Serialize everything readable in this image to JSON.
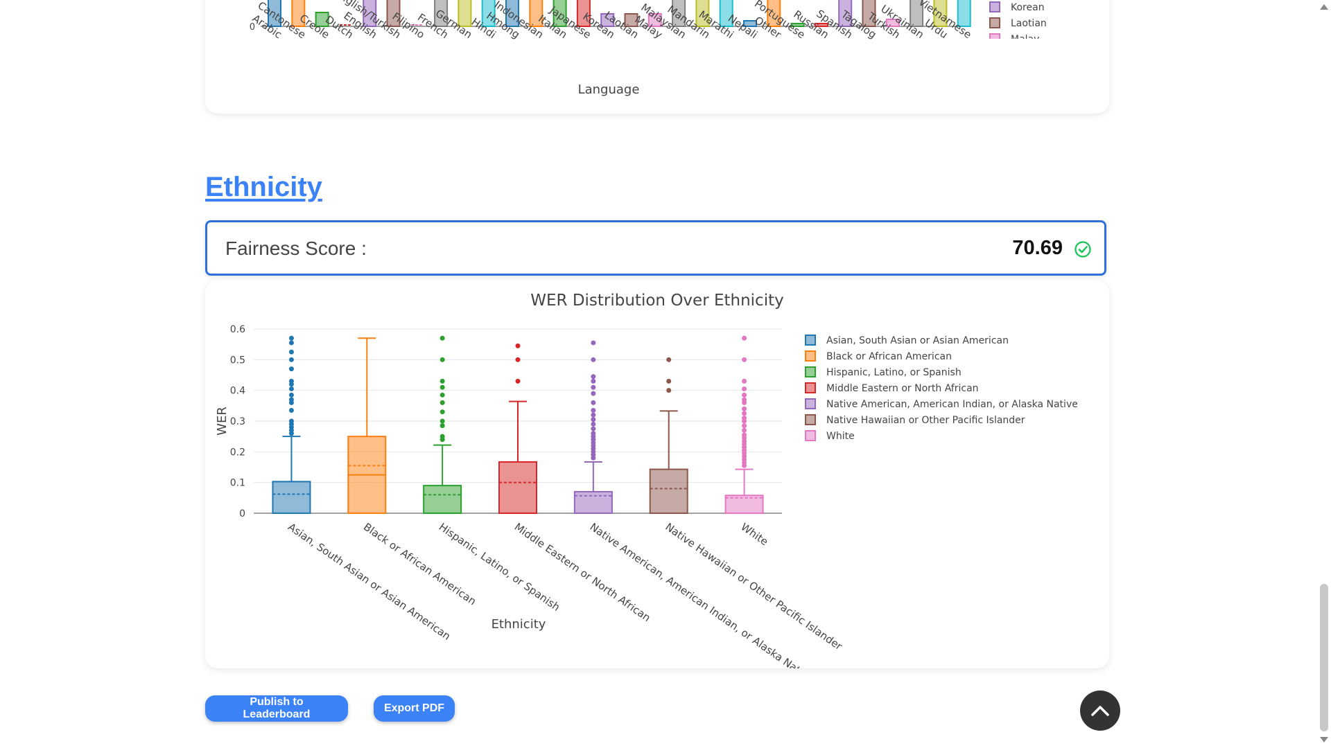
{
  "language_section": {
    "xlabel": "Language",
    "categories": [
      "Arabic",
      "Cantonese",
      "Creole",
      "Dutch",
      "English",
      "English/Turkish",
      "Filipino",
      "French",
      "German",
      "Hindi",
      "Hmong",
      "Indonesian",
      "Italian",
      "Japanese",
      "Korean",
      "Laotian",
      "Malay",
      "Malaysian",
      "Mandarin",
      "Marathi",
      "Nepali",
      "Other",
      "Portuguese",
      "Russian",
      "Spanish",
      "Tagalog",
      "Turkish",
      "Ukrainian",
      "Urdu",
      "Vietnamese"
    ],
    "colors": [
      "#1f77b4",
      "#ff7f0e",
      "#2ca02c",
      "#d62728",
      "#9467bd",
      "#8c564b",
      "#e377c2",
      "#7f7f7f",
      "#bcbd22",
      "#17becf",
      "#1f77b4",
      "#ff7f0e",
      "#2ca02c",
      "#d62728",
      "#9467bd",
      "#8c564b",
      "#e377c2",
      "#7f7f7f",
      "#bcbd22",
      "#17becf",
      "#1f77b4",
      "#ff7f0e",
      "#2ca02c",
      "#d62728",
      "#9467bd",
      "#8c564b",
      "#e377c2",
      "#7f7f7f",
      "#bcbd22",
      "#17becf"
    ],
    "zero_tick": "0",
    "legend_visible": [
      "Korean",
      "Laotian",
      "Malay"
    ],
    "legend_colors": [
      "#9467bd",
      "#8c564b",
      "#e377c2"
    ]
  },
  "ethnicity_section": {
    "title": "Ethnicity",
    "fairness_label": "Fairness Score :",
    "fairness_value": "70.69",
    "check_icon_color": "#22c55e"
  },
  "chart_data": {
    "type": "box",
    "title": "WER Distribution Over Ethnicity",
    "xlabel": "Ethnicity",
    "ylabel": "WER",
    "ylim": [
      0,
      0.6
    ],
    "yticks": [
      0,
      0.1,
      0.2,
      0.3,
      0.4,
      0.5,
      0.6
    ],
    "ytick_labels": [
      "0",
      "0.1",
      "0.2",
      "0.3",
      "0.4",
      "0.5",
      "0.6"
    ],
    "grid": true,
    "legend_position": "right",
    "series": [
      {
        "name": "Asian, South Asian or Asian American",
        "color": "#1f77b4",
        "q1": 0,
        "median": 0,
        "q3": 0.103,
        "lower": 0,
        "upper": 0.25,
        "mean": 0.062,
        "outliers": [
          0.57,
          0.555,
          0.525,
          0.5,
          0.47,
          0.43,
          0.42,
          0.405,
          0.385,
          0.37,
          0.36,
          0.335,
          0.3,
          0.29,
          0.28,
          0.27,
          0.26
        ]
      },
      {
        "name": "Black or African American",
        "color": "#ff7f0e",
        "q1": 0,
        "median": 0.125,
        "q3": 0.25,
        "lower": 0,
        "upper": 0.57,
        "mean": 0.155,
        "outliers": []
      },
      {
        "name": "Hispanic, Latino, or Spanish",
        "color": "#2ca02c",
        "q1": 0,
        "median": 0,
        "q3": 0.09,
        "lower": 0,
        "upper": 0.222,
        "mean": 0.06,
        "outliers": [
          0.57,
          0.5,
          0.43,
          0.41,
          0.385,
          0.36,
          0.33,
          0.3,
          0.285,
          0.25,
          0.24
        ]
      },
      {
        "name": "Middle Eastern or North African",
        "color": "#d62728",
        "q1": 0,
        "median": 0,
        "q3": 0.167,
        "lower": 0,
        "upper": 0.364,
        "mean": 0.1,
        "outliers": [
          0.545,
          0.5,
          0.43
        ]
      },
      {
        "name": "Native American, American Indian, or Alaska Native",
        "color": "#9467bd",
        "q1": 0,
        "median": 0,
        "q3": 0.07,
        "lower": 0,
        "upper": 0.167,
        "mean": 0.057,
        "outliers": [
          0.555,
          0.5,
          0.445,
          0.43,
          0.41,
          0.39,
          0.36,
          0.335,
          0.32,
          0.305,
          0.29,
          0.275,
          0.26,
          0.25,
          0.24,
          0.23,
          0.22,
          0.21,
          0.2,
          0.19,
          0.18
        ]
      },
      {
        "name": "Native Hawaiian or Other Pacific Islander",
        "color": "#8c564b",
        "q1": 0,
        "median": 0,
        "q3": 0.143,
        "lower": 0,
        "upper": 0.333,
        "mean": 0.08,
        "outliers": [
          0.5,
          0.43,
          0.4
        ]
      },
      {
        "name": "White",
        "color": "#e377c2",
        "q1": 0,
        "median": 0,
        "q3": 0.058,
        "lower": 0,
        "upper": 0.143,
        "mean": 0.05,
        "outliers": [
          0.57,
          0.5,
          0.43,
          0.405,
          0.385,
          0.37,
          0.36,
          0.34,
          0.325,
          0.31,
          0.3,
          0.285,
          0.27,
          0.255,
          0.245,
          0.235,
          0.225,
          0.215,
          0.205,
          0.195,
          0.185,
          0.175,
          0.165,
          0.155
        ]
      }
    ]
  },
  "buttons": {
    "publish": "Publish to Leaderboard",
    "export": "Export PDF"
  },
  "icons": {
    "scroll_top": "chevron-up-icon",
    "check": "check-circle-icon"
  }
}
